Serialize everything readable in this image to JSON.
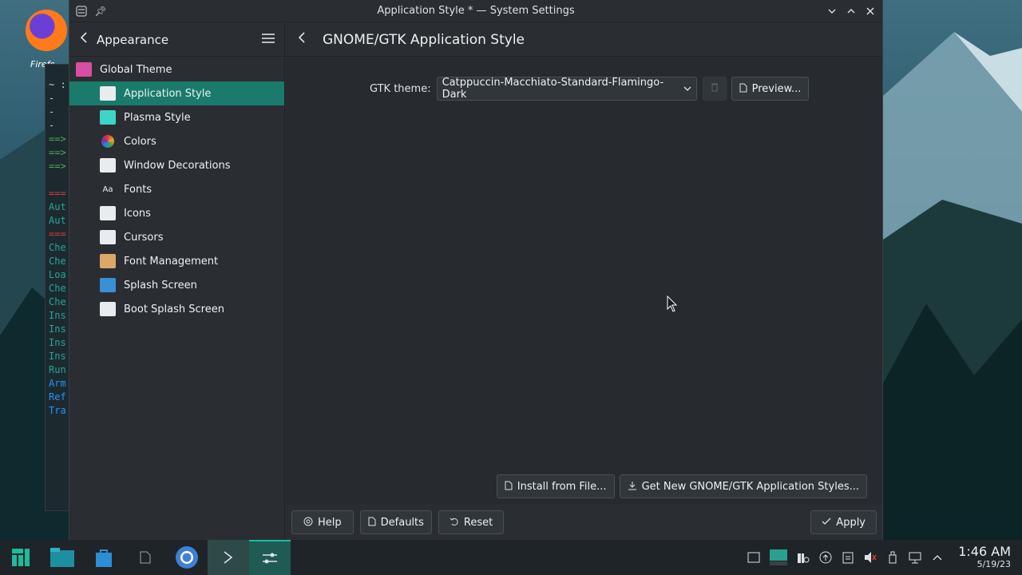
{
  "desktop": {
    "firefox_label": "Firefox",
    "terminal_lines": [
      {
        "text": "",
        "color": "#9aa"
      },
      {
        "text": "~ :",
        "color": "#cfd8dc"
      },
      {
        "text": "  -",
        "color": "#cfd8dc"
      },
      {
        "text": "  -",
        "color": "#cfd8dc"
      },
      {
        "text": "  -",
        "color": "#cfd8dc"
      },
      {
        "text": "==>",
        "color": "#4caf50"
      },
      {
        "text": "==>",
        "color": "#4caf50"
      },
      {
        "text": "==>",
        "color": "#4caf50"
      },
      {
        "text": "",
        "color": "#cfd8dc"
      },
      {
        "text": "===",
        "color": "#e53935"
      },
      {
        "text": "Aut",
        "color": "#26a69a"
      },
      {
        "text": "Aut",
        "color": "#26a69a"
      },
      {
        "text": "===",
        "color": "#e53935"
      },
      {
        "text": "Che",
        "color": "#26a69a"
      },
      {
        "text": "Che",
        "color": "#26a69a"
      },
      {
        "text": "Loa",
        "color": "#26a69a"
      },
      {
        "text": "Che",
        "color": "#26a69a"
      },
      {
        "text": "Che",
        "color": "#26a69a"
      },
      {
        "text": "Ins",
        "color": "#26a69a"
      },
      {
        "text": "Ins",
        "color": "#26a69a"
      },
      {
        "text": "Ins",
        "color": "#26a69a"
      },
      {
        "text": "Ins",
        "color": "#26a69a"
      },
      {
        "text": "Run",
        "color": "#26a69a"
      },
      {
        "text": "Arm",
        "color": "#2196f3"
      },
      {
        "text": "Ref",
        "color": "#2196f3"
      },
      {
        "text": "Tra",
        "color": "#2196f3"
      }
    ]
  },
  "window": {
    "title": "Application Style * — System Settings"
  },
  "sidebar": {
    "header": "Appearance",
    "items": [
      {
        "label": "Global Theme",
        "level": "top",
        "active": false,
        "icon": "global-theme-icon",
        "color": "#d64fa0"
      },
      {
        "label": "Application Style",
        "level": "sub",
        "active": true,
        "icon": "application-style-icon",
        "color": "#e8ecef"
      },
      {
        "label": "Plasma Style",
        "level": "sub",
        "active": false,
        "icon": "plasma-style-icon",
        "color": "#3dd6c6"
      },
      {
        "label": "Colors",
        "level": "sub",
        "active": false,
        "icon": "colors-icon",
        "color": "#f0a030"
      },
      {
        "label": "Window Decorations",
        "level": "sub",
        "active": false,
        "icon": "window-decorations-icon",
        "color": "#e8ecef"
      },
      {
        "label": "Fonts",
        "level": "sub",
        "active": false,
        "icon": "fonts-icon",
        "color": "#3a3f44"
      },
      {
        "label": "Icons",
        "level": "sub",
        "active": false,
        "icon": "icons-icon",
        "color": "#e8ecef"
      },
      {
        "label": "Cursors",
        "level": "sub",
        "active": false,
        "icon": "cursors-icon",
        "color": "#e8ecef"
      },
      {
        "label": "Font Management",
        "level": "sub",
        "active": false,
        "icon": "font-management-icon",
        "color": "#d9a86a"
      },
      {
        "label": "Splash Screen",
        "level": "sub",
        "active": false,
        "icon": "splash-screen-icon",
        "color": "#3a8fd6"
      },
      {
        "label": "Boot Splash Screen",
        "level": "sub",
        "active": false,
        "icon": "boot-splash-screen-icon",
        "color": "#e8ecef"
      }
    ]
  },
  "main": {
    "title": "GNOME/GTK Application Style",
    "gtk_label": "GTK theme:",
    "gtk_value": "Catppuccin-Macchiato-Standard-Flamingo-Dark",
    "preview_label": "Preview...",
    "install_label": "Install from File...",
    "get_new_label": "Get New GNOME/GTK Application Styles..."
  },
  "footer": {
    "help": "Help",
    "defaults": "Defaults",
    "reset": "Reset",
    "apply": "Apply"
  },
  "taskbar": {
    "time": "1:46 AM",
    "date": "5/19/23",
    "accent": "#1abc9c"
  }
}
